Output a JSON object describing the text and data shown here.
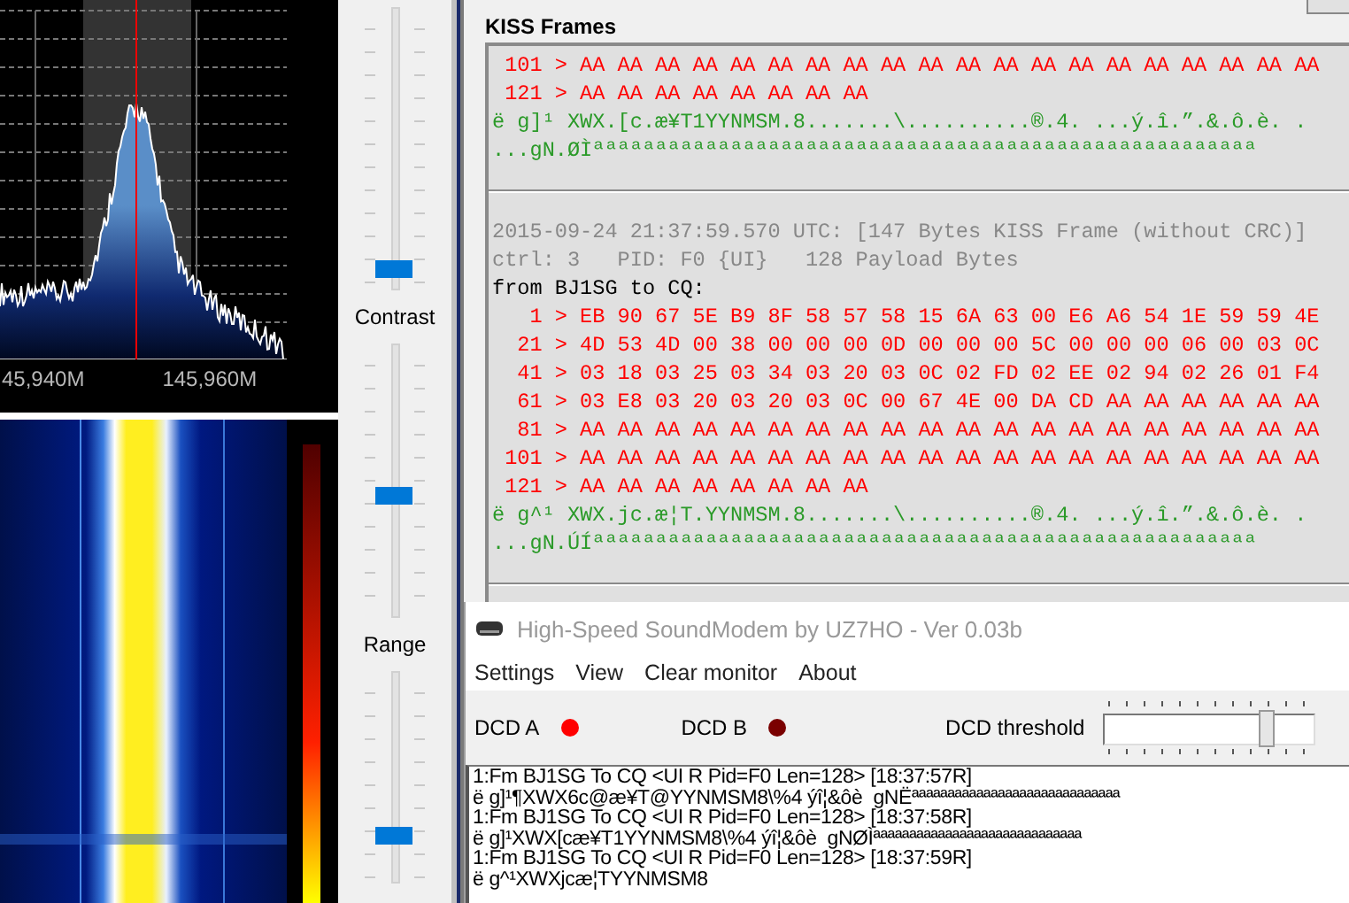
{
  "spectrum": {
    "freq_labels": [
      "45,940M",
      "145,960M"
    ]
  },
  "sliders": [
    {
      "label": "Contrast",
      "level": 0.05
    },
    {
      "label": "Range",
      "level": 0.44
    },
    {
      "level": 0.2
    }
  ],
  "kiss_frames": {
    "title": "KISS Frames",
    "lines": [
      {
        "kind": "hex",
        "text": " 101 > AA AA AA AA AA AA AA AA AA AA AA AA AA AA AA AA AA AA AA AA"
      },
      {
        "kind": "hex",
        "text": " 121 > AA AA AA AA AA AA AA AA"
      },
      {
        "kind": "ascii",
        "text": "ë g]¹ XWX.[c.æ¥T1YYNMSM.8.......\\..........®.4. ...ý.î.”.&.ô.è. ."
      },
      {
        "kind": "ascii",
        "text": "...gN.ØÌªªªªªªªªªªªªªªªªªªªªªªªªªªªªªªªªªªªªªªªªªªªªªªªªªªªªª"
      },
      {
        "kind": "separator"
      },
      {
        "kind": "header",
        "text": "2015-09-24 21:37:59.570 UTC: [147 Bytes KISS Frame (without CRC)]"
      },
      {
        "kind": "header",
        "text": "ctrl: 3   PID: F0 {UI}   128 Payload Bytes"
      },
      {
        "kind": "from",
        "text": "from BJ1SG to CQ:"
      },
      {
        "kind": "hex",
        "text": "   1 > EB 90 67 5E B9 8F 58 57 58 15 6A 63 00 E6 A6 54 1E 59 59 4E"
      },
      {
        "kind": "hex",
        "text": "  21 > 4D 53 4D 00 38 00 00 00 0D 00 00 00 5C 00 00 00 06 00 03 0C"
      },
      {
        "kind": "hex",
        "text": "  41 > 03 18 03 25 03 34 03 20 03 0C 02 FD 02 EE 02 94 02 26 01 F4"
      },
      {
        "kind": "hex",
        "text": "  61 > 03 E8 03 20 03 20 03 0C 00 67 4E 00 DA CD AA AA AA AA AA AA"
      },
      {
        "kind": "hex",
        "text": "  81 > AA AA AA AA AA AA AA AA AA AA AA AA AA AA AA AA AA AA AA AA"
      },
      {
        "kind": "hex",
        "text": " 101 > AA AA AA AA AA AA AA AA AA AA AA AA AA AA AA AA AA AA AA AA"
      },
      {
        "kind": "hex",
        "text": " 121 > AA AA AA AA AA AA AA AA"
      },
      {
        "kind": "ascii",
        "text": "ë g^¹ XWX.jc.æ¦T.YYNMSM.8.......\\..........®.4. ...ý.î.”.&.ô.è. ."
      },
      {
        "kind": "ascii",
        "text": "...gN.ÚÍªªªªªªªªªªªªªªªªªªªªªªªªªªªªªªªªªªªªªªªªªªªªªªªªªªªªª"
      },
      {
        "kind": "separator"
      }
    ]
  },
  "soundmodem": {
    "title": "High-Speed SoundModem by UZ7HO - Ver 0.03b",
    "menu": [
      "Settings",
      "View",
      "Clear monitor",
      "About"
    ],
    "dcd": [
      {
        "label": "DCD A",
        "on": true
      },
      {
        "label": "DCD B",
        "on": false
      }
    ],
    "threshold": {
      "label": "DCD threshold",
      "level": 0.78
    },
    "monitor": [
      "1:Fm BJ1SG To CQ <UI R Pid=F0 Len=128> [18:37:57R]",
      "ë g]¹¶XWX6c@æ¥T@YYNMSM8\\%4 ýî¦&ôè  gNËªªªªªªªªªªªªªªªªªªªªªªªªªªªªª",
      "1:Fm BJ1SG To CQ <UI R Pid=F0 Len=128> [18:37:58R]",
      "ë g]¹XWX[cæ¥T1YYNMSM8\\%4 ýî¦&ôè  gNØÌªªªªªªªªªªªªªªªªªªªªªªªªªªªªª",
      "1:Fm BJ1SG To CQ <UI R Pid=F0 Len=128> [18:37:59R]",
      "ë g^¹XWXjcæ¦TYYNMSM8"
    ]
  }
}
